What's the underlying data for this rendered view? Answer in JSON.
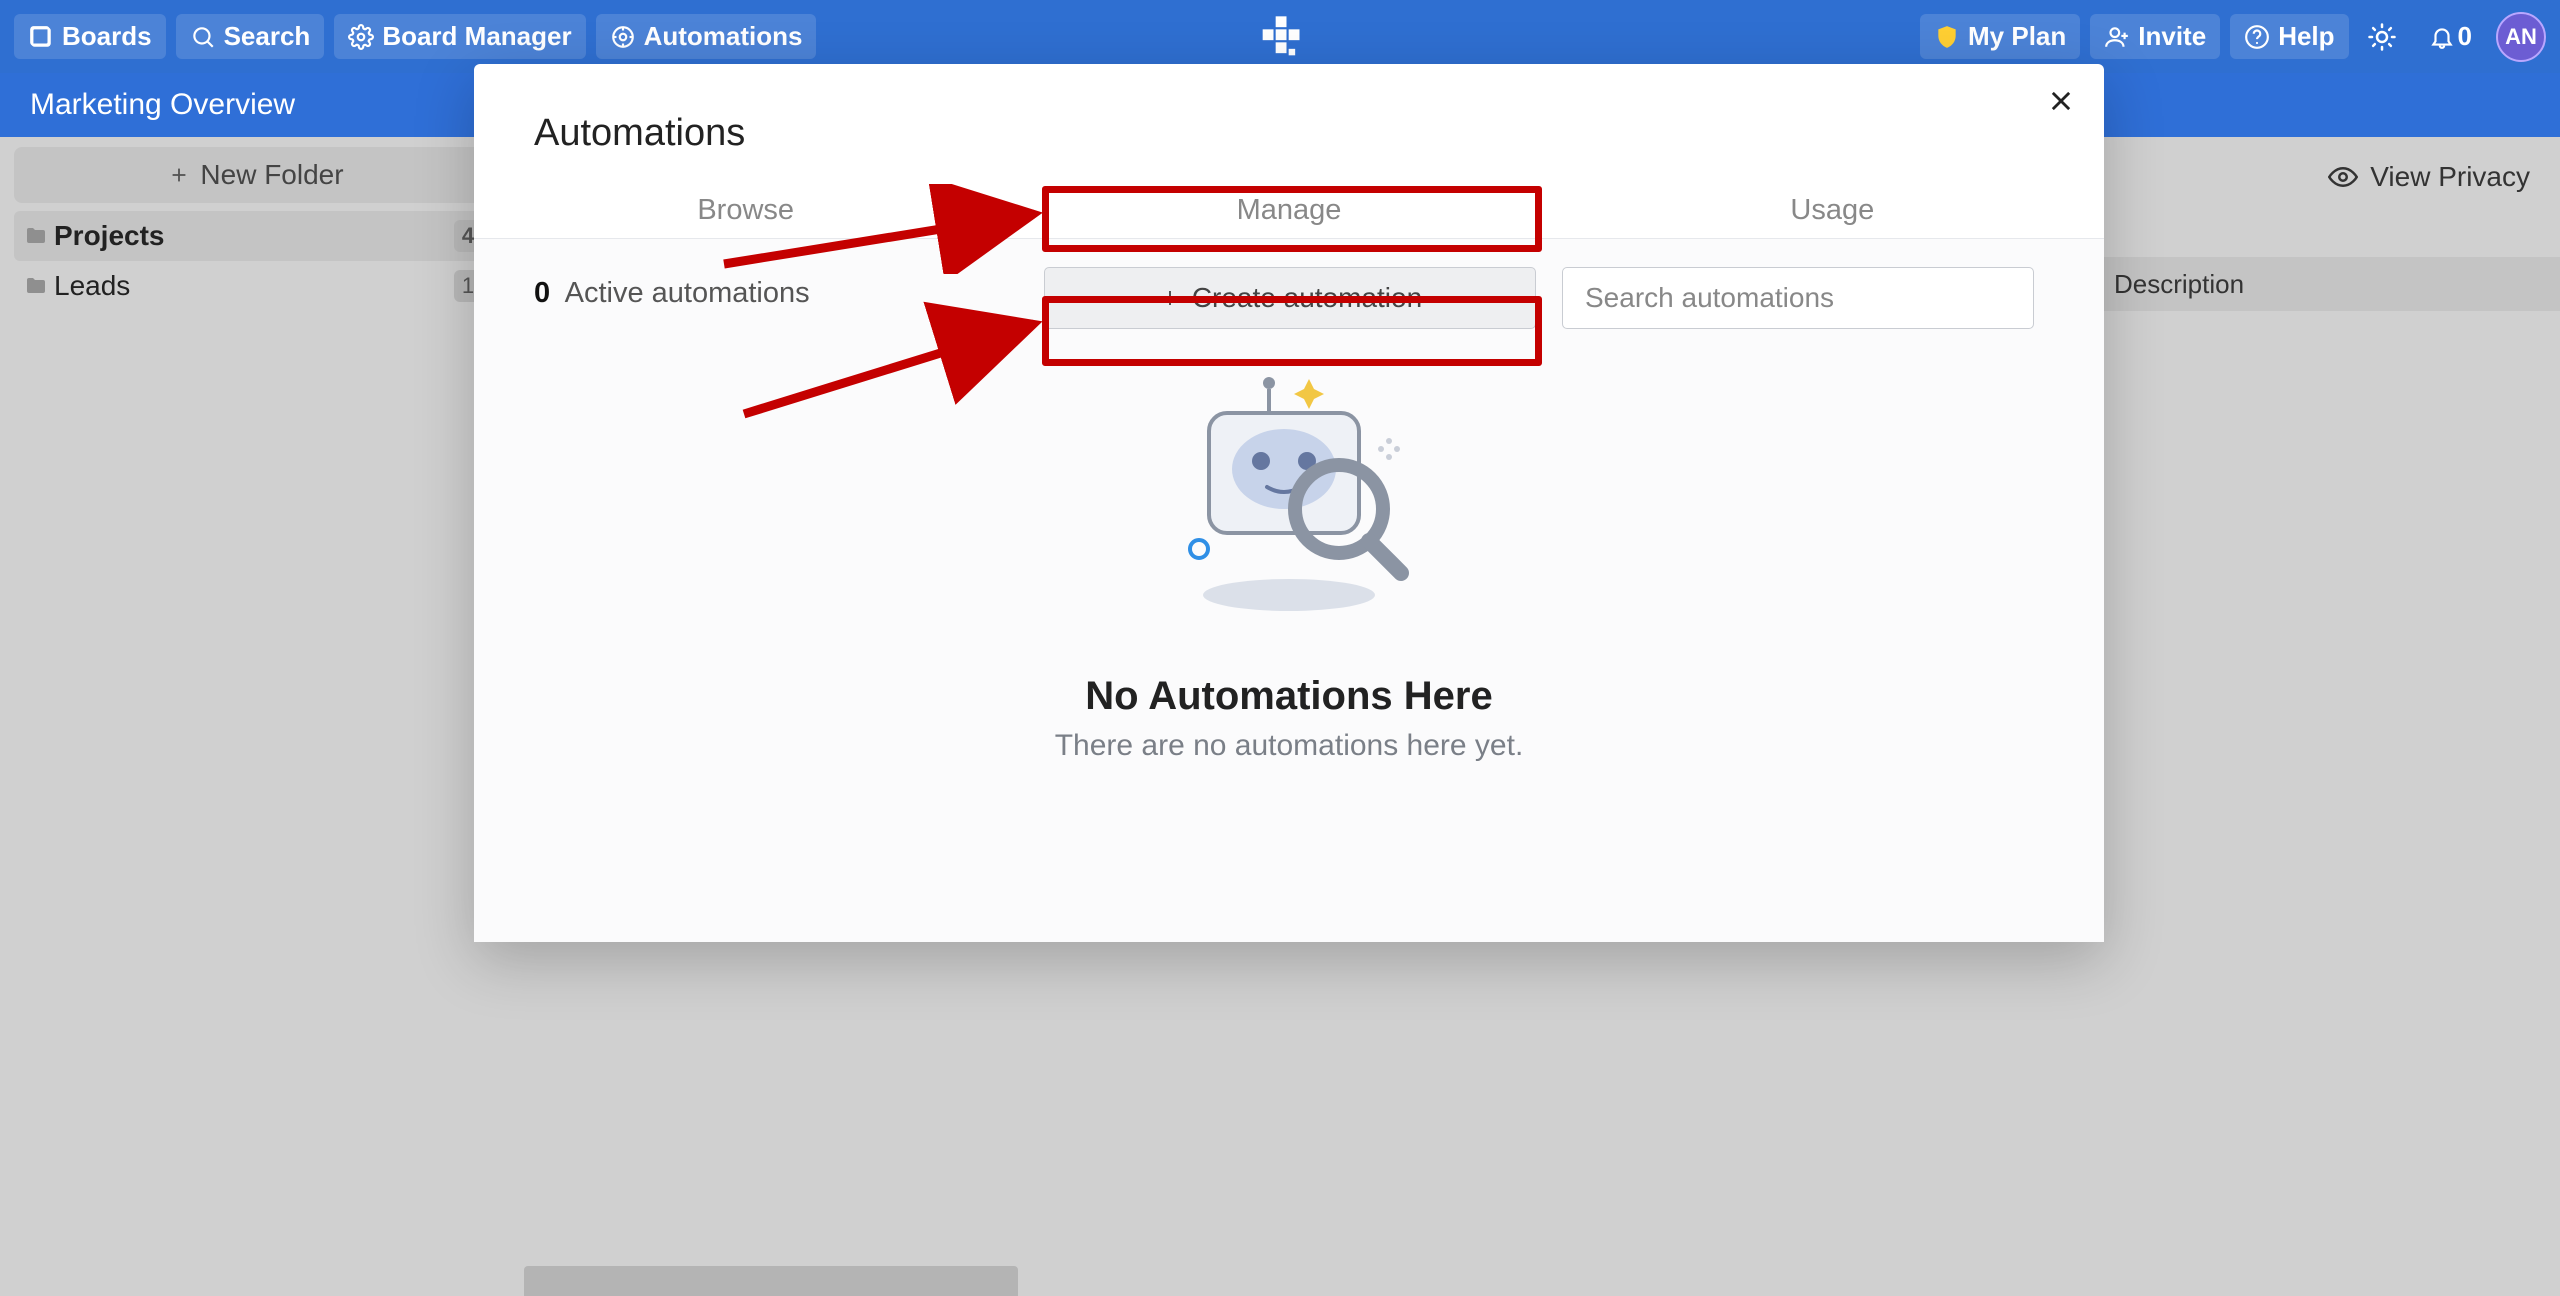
{
  "nav": {
    "boards": "Boards",
    "search": "Search",
    "board_manager": "Board Manager",
    "automations": "Automations",
    "my_plan": "My Plan",
    "invite": "Invite",
    "help": "Help",
    "notif_count": "0",
    "avatar": "AN"
  },
  "subnav": {
    "title": "Marketing Overview"
  },
  "sidebar": {
    "new_folder": "New Folder",
    "items": [
      {
        "label": "Projects",
        "count": "4"
      },
      {
        "label": "Leads",
        "count": "1"
      }
    ]
  },
  "main": {
    "view_privacy": "View Privacy",
    "column_header": "Description"
  },
  "modal": {
    "title": "Automations",
    "tabs": {
      "browse": "Browse",
      "manage": "Manage",
      "usage": "Usage"
    },
    "active_count": "0",
    "active_label": "Active automations",
    "create_label": "Create automation",
    "search_placeholder": "Search automations",
    "empty_title": "No Automations Here",
    "empty_sub": "There are no automations here yet."
  }
}
